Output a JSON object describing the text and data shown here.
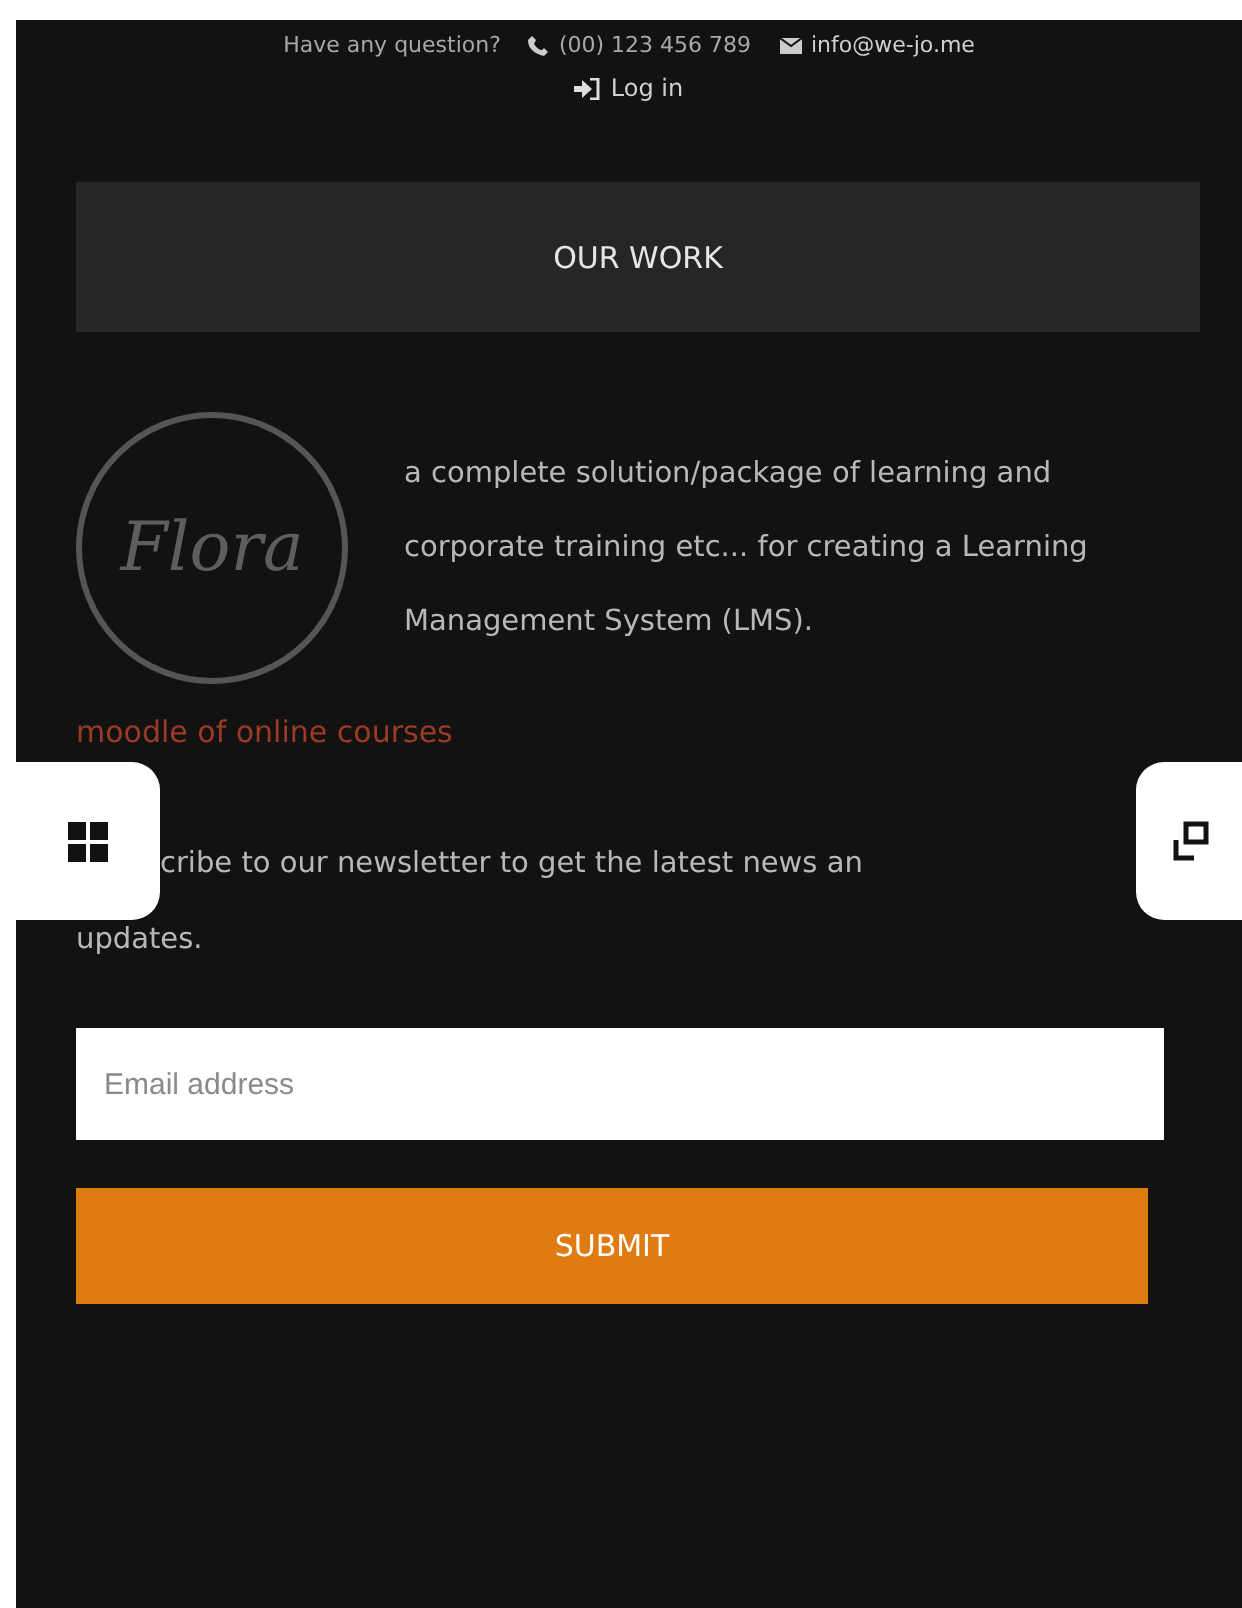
{
  "topbar": {
    "question": "Have any question?",
    "phone": "(00) 123 456 789",
    "email": "info@we-jo.me",
    "login": "Log in"
  },
  "section_title": "OUR WORK",
  "work": {
    "logo_text": "Flora",
    "description": "a complete solution/package of learning and corporate training etc... for creating a Learning Management System (LMS).",
    "link": "moodle of online courses"
  },
  "newsletter": {
    "text_line_1": "cribe to our newsletter to get the latest news an",
    "text_line_2": "updates.",
    "placeholder": "Email address",
    "button": "SUBMIT"
  }
}
